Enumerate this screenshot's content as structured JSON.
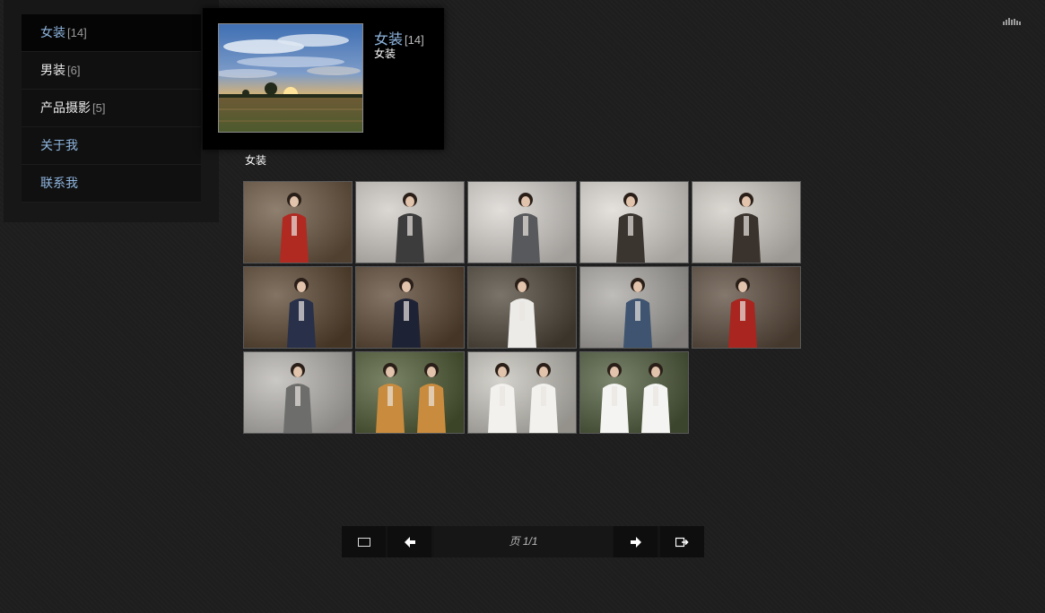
{
  "menu": {
    "items": [
      {
        "label": "女装",
        "count": "[14]",
        "active": true,
        "color": "#8fb6e0"
      },
      {
        "label": "男装",
        "count": "[6]",
        "active": false,
        "color": "#ececec"
      },
      {
        "label": "产品摄影",
        "count": "[5]",
        "active": false,
        "color": "#ececec"
      },
      {
        "label": "关于我",
        "count": "",
        "active": false,
        "color": "#8fb6e0"
      },
      {
        "label": "联系我",
        "count": "",
        "active": false,
        "color": "#8fb6e0"
      }
    ]
  },
  "popup": {
    "title": "女装",
    "count": "[14]",
    "description": "女装",
    "image": "sunset-field-photo"
  },
  "gallery": {
    "title": "女装",
    "photos": [
      {
        "subject": "woman-red-leather-jacket",
        "bg": "#6a5540",
        "coat": "#b02a22"
      },
      {
        "subject": "woman-grey-coat",
        "bg": "#cfcac4",
        "coat": "#3c3c3c"
      },
      {
        "subject": "woman-grey-coat-hat",
        "bg": "#d8d4cf",
        "coat": "#58595c"
      },
      {
        "subject": "woman-brown-jacket-cap",
        "bg": "#dcd8d2",
        "coat": "#3b3530"
      },
      {
        "subject": "woman-brown-jacket",
        "bg": "#d0cbc4",
        "coat": "#3a332d"
      },
      {
        "subject": "woman-navy-coat-seated",
        "bg": "#5a4530",
        "coat": "#28304a"
      },
      {
        "subject": "woman-plaid-skirt",
        "bg": "#5a4632",
        "coat": "#1e2235"
      },
      {
        "subject": "woman-white-blouse",
        "bg": "#4e4538",
        "coat": "#ecebe8"
      },
      {
        "subject": "woman-denim-jacket",
        "bg": "#aaa7a2",
        "coat": "#3e5470"
      },
      {
        "subject": "woman-red-coat",
        "bg": "#5b4a3c",
        "coat": "#a8261f"
      },
      {
        "subject": "woman-tweed-jacket",
        "bg": "#b9b6b2",
        "coat": "#6d6d6b"
      },
      {
        "subject": "women-fur-vests",
        "bg": "#4e5a33",
        "coat": "#c98c3e"
      },
      {
        "subject": "women-white-cardigans",
        "bg": "#c6c3bb",
        "coat": "#f2f1ee"
      },
      {
        "subject": "women-white-tops-black-skirts",
        "bg": "#4e5a3a",
        "coat": "#f4f4f2"
      }
    ]
  },
  "pager": {
    "page_text": "页 1/1",
    "buttons": [
      "slideshow-icon",
      "previous-arrow-icon",
      "next-arrow-icon",
      "exit-icon"
    ]
  },
  "topbar": {
    "icon": "equalizer-icon"
  }
}
